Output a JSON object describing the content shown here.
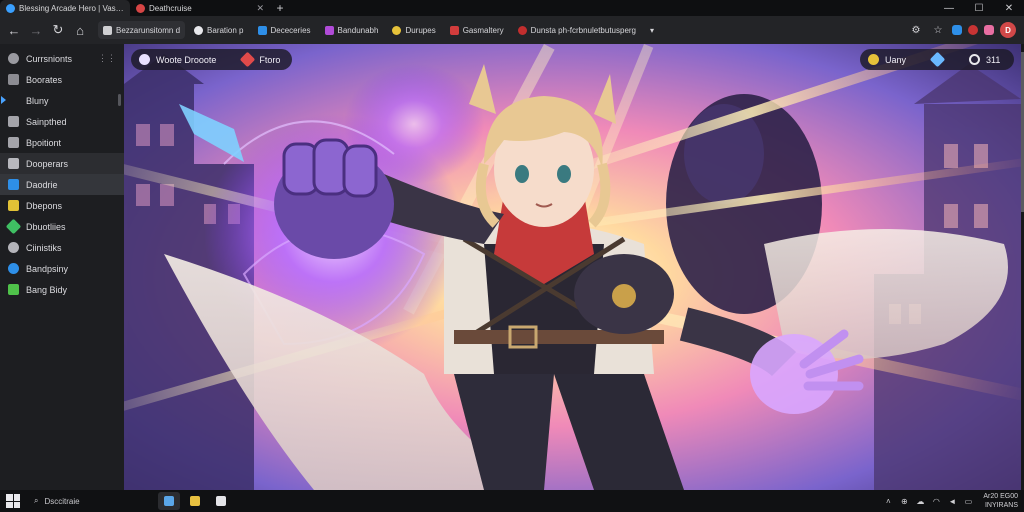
{
  "tabs": [
    {
      "title": "Blessing Arcade Hero | Vast Ql · Gt",
      "favicon_color": "#3aa0ff",
      "active": true
    },
    {
      "title": "Deathcruise",
      "favicon_color": "#d64545",
      "active": false
    }
  ],
  "new_tab_label": "+",
  "window_controls": {
    "minimize": "—",
    "maximize": "☐",
    "close": "✕"
  },
  "toolbar": {
    "back": "←",
    "forward": "→",
    "reload": "↻",
    "home": "⌂",
    "bookmarks": [
      {
        "label": "Bezzarunsitomn d",
        "icon": "folder-icon",
        "color": "#cfcfd2",
        "boxed": true
      },
      {
        "label": "Baration p",
        "icon": "d-badge-icon",
        "color": "#e8e8ec",
        "boxed": false
      },
      {
        "label": "Dececeries",
        "icon": "blue-square-icon",
        "color": "#2e8fe8",
        "boxed": false
      },
      {
        "label": "Bandunabh",
        "icon": "purple-d-icon",
        "color": "#b04bd8",
        "boxed": false
      },
      {
        "label": "Durupes",
        "icon": "yellow-coin-icon",
        "color": "#e6c23a",
        "boxed": false
      },
      {
        "label": "Gasmaltery",
        "icon": "red-shield-icon",
        "color": "#d23c3c",
        "boxed": false
      },
      {
        "label": "Dunsta ph-fcrbnuletbutusperg",
        "icon": "red-drop-icon",
        "color": "#c22e2e",
        "boxed": false
      }
    ],
    "overflow": "▾",
    "right_icons": [
      "puzzle-icon",
      "star-icon",
      "blue-ext-icon",
      "red-ext-icon",
      "pink-ext-icon"
    ],
    "profile_letter": "D"
  },
  "sidebar": {
    "items": [
      {
        "label": "Currsnionts",
        "icon": "home-icon",
        "color": "#9a9aa0",
        "extra": "⋮⋮"
      },
      {
        "label": "Boorates",
        "icon": "grid-icon",
        "color": "#8c8c92",
        "extra": ""
      },
      {
        "label": "Bluny",
        "icon": "cursor-icon",
        "color": "#4aa3ff",
        "extra": "",
        "marker": true
      },
      {
        "label": "Sainpthed",
        "icon": "doc-icon",
        "color": "#a4a4aa",
        "extra": ""
      },
      {
        "label": "Bpoitiont",
        "icon": "bars-icon",
        "color": "#a4a4aa",
        "extra": ""
      },
      {
        "label": "Dooperars",
        "icon": "file-icon",
        "color": "#b8b8be",
        "extra": "",
        "highlight": true
      },
      {
        "label": "Daodrie",
        "icon": "folder-blue-icon",
        "color": "#2e8fe8",
        "extra": "",
        "selected": true
      },
      {
        "label": "Dbepons",
        "icon": "shield-yellow-icon",
        "color": "#e2c236",
        "extra": ""
      },
      {
        "label": "Dbuotliies",
        "icon": "leaf-icon",
        "color": "#3fbf63",
        "extra": ""
      },
      {
        "label": "Ciinistiks",
        "icon": "people-icon",
        "color": "#b4b4ba",
        "extra": ""
      },
      {
        "label": "Bandpsiny",
        "icon": "refresh-blue-icon",
        "color": "#2e8fe8",
        "extra": ""
      },
      {
        "label": "Bang Bidy",
        "icon": "green-tile-icon",
        "color": "#4fc24a",
        "extra": ""
      }
    ]
  },
  "overlay": {
    "left": {
      "label": "Woote Drooote",
      "icon": "spark-icon",
      "label2": "Ftoro",
      "icon2": "ruby-icon"
    },
    "right": {
      "label": "Uany",
      "icon": "coin-icon",
      "icon2": "gem-icon",
      "icon3": "settings-icon",
      "value": "311"
    }
  },
  "taskbar": {
    "search_text": "Dsccitraie",
    "apps": [
      {
        "icon": "app-blue-icon",
        "color": "#5aa6e8",
        "active": true
      },
      {
        "icon": "app-yellow-icon",
        "color": "#e8c040",
        "active": false
      },
      {
        "icon": "app-white-icon",
        "color": "#e4e4e8",
        "active": false
      }
    ],
    "tray_icons": [
      "chevron-up-icon",
      "network-icon",
      "cloud-icon",
      "wifi-icon",
      "volume-icon",
      "battery-icon"
    ],
    "time": "Ar20 EG00",
    "date": "INYIRANS"
  },
  "artwork": {
    "description_colors": {
      "sky": "#8a74d8",
      "burst": "#ffe6a8",
      "purple_glow": "#b06cff",
      "cape": "#f2ece6",
      "hair": "#e8c893"
    }
  }
}
